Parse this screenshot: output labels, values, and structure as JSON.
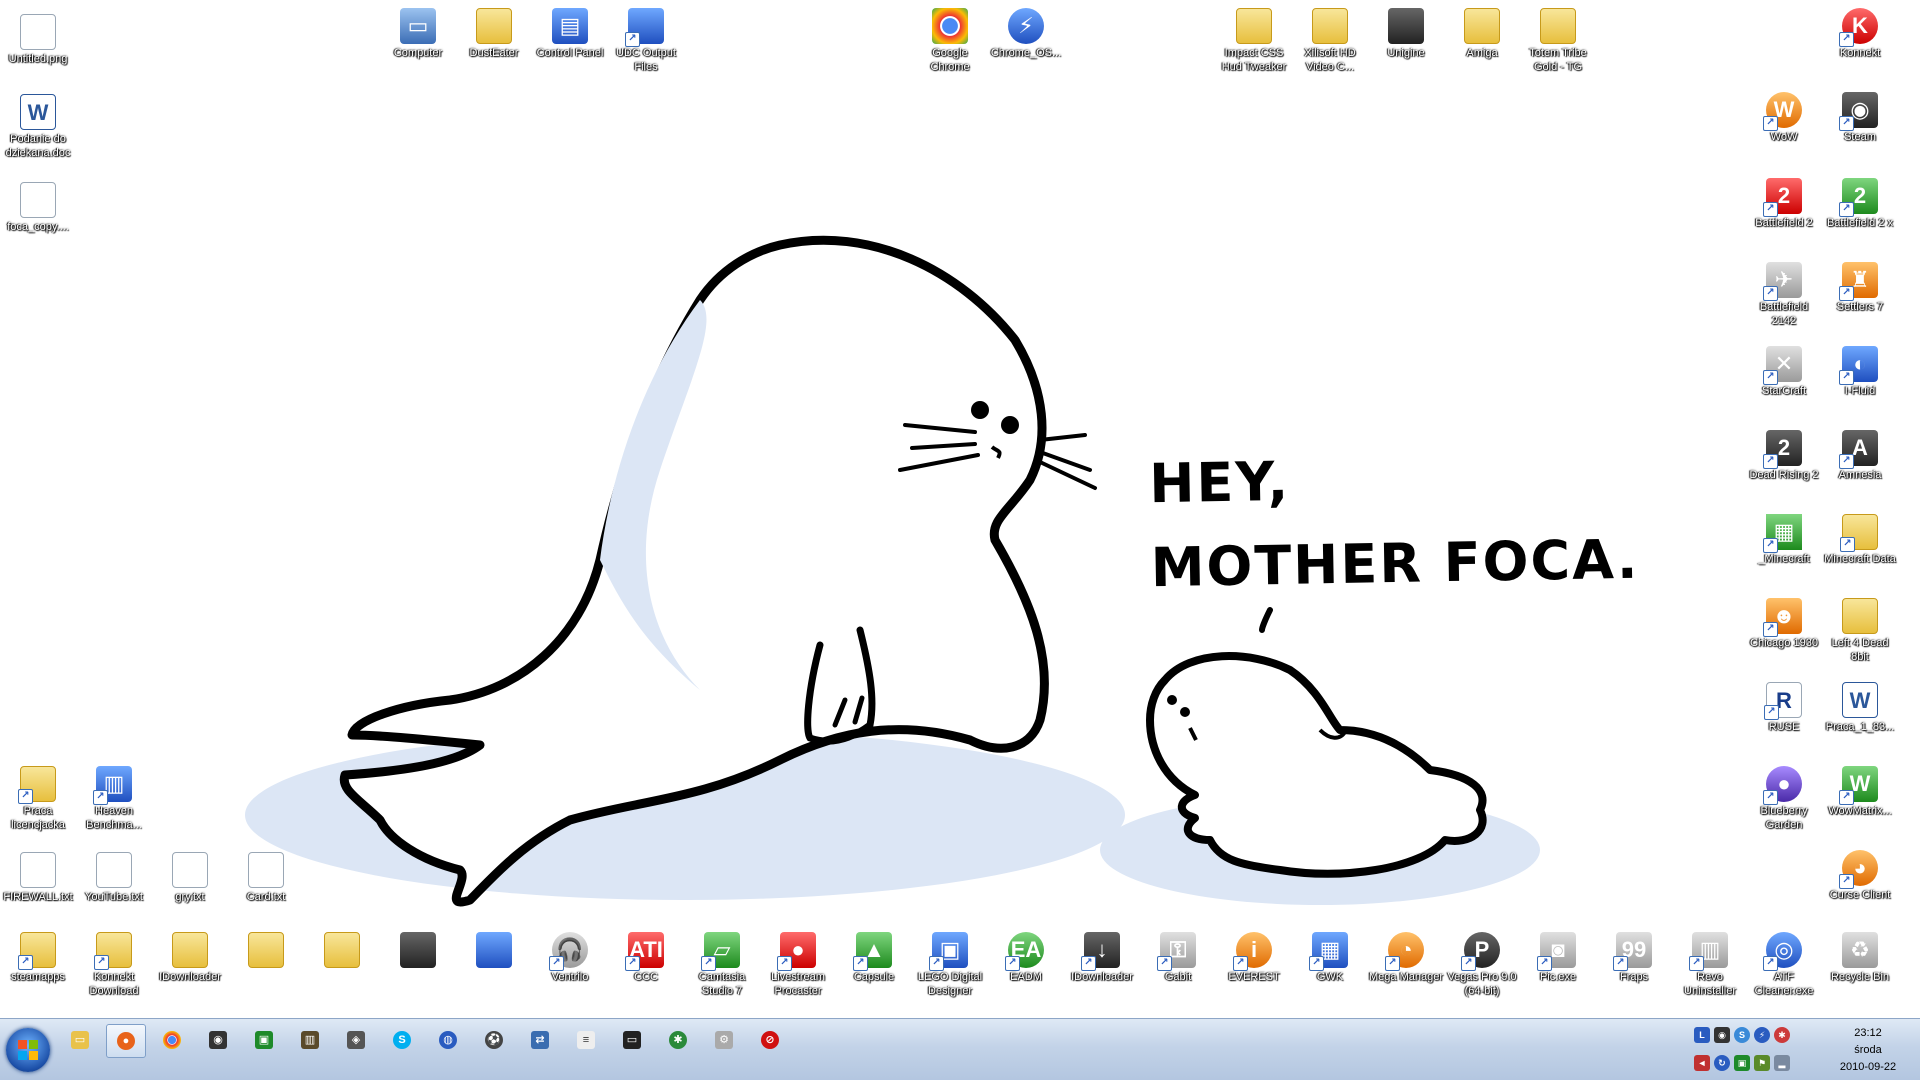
{
  "wallpaper": {
    "speech_line1": "HEY,",
    "speech_line2": "MOTHER FOCA."
  },
  "desktop_icons": {
    "untitled_png": "Untitled.png",
    "podanie_doc": "Podanie do dziekana.doc",
    "foca_copy": "foca_copy....",
    "computer": "Computer",
    "dusteater": "DustEater",
    "control_panel": "Control Panel",
    "udc_output": "UDC Output Files",
    "google_chrome": "Google Chrome",
    "chrome_os": "Chrome_OS...",
    "impact_css": "Impact CSS Hud Tweaker",
    "xilisoft": "Xilisoft HD Video C...",
    "unigine": "Unigine",
    "amiga": "Amiga",
    "totem_tribe": "Totem Tribe Gold - TG",
    "konnekt_top": "Konnekt",
    "wow": "WoW",
    "steam": "Steam",
    "bf2": "Battlefield 2",
    "bf2x": "Battlefield 2 x",
    "bf2142": "Battlefield 2142",
    "settlers7": "Settlers 7",
    "starcraft": "StarCraft",
    "i_fluid": "I-Fluid",
    "dead_rising": "Dead Rising 2",
    "amnesia": "Amnesia",
    "minecraft": "_Minecraft",
    "minecraft_data": "Minecraft Data",
    "chicago": "Chicago 1930",
    "left4dead": "Left 4 Dead 8bit",
    "ruse": "RUSE",
    "praca_doc": "Praca_1_83...",
    "blueberry": "Blueberry Garden",
    "wowmatrix": "WowMatrix...",
    "curse": "Curse Client",
    "praca_lic": "Praca licencjacka",
    "heaven": "Heaven Benchma...",
    "firewall": "FIREWALL.txt",
    "youtube": "YouTube.txt",
    "gry": "gry.txt",
    "card": "Card.txt",
    "steamapps": "steamapps",
    "konnekt_dl": "Konnekt Download",
    "idownloader_folder": "IDownloader",
    "ventrilo": "Ventrilo",
    "ccc": "CCC",
    "camtasia": "Camtasia Studio 7",
    "livestream": "Livestream Procaster",
    "capsule": "Capsule",
    "lego": "LEGO Digital Designer",
    "eadm": "EADM",
    "idownloader": "IDownloader",
    "gabit": "Gabit",
    "everest": "EVEREST",
    "gwk": "GWK",
    "mega_manager": "Mega Manager",
    "vegas": "Vegas Pro 9.0 (64-bit)",
    "pic_exe": "Pic.exe",
    "fraps": "Fraps",
    "revo": "Revo Uninstaller",
    "atf": "ATF Cleaner.exe",
    "recycle_bin": "Recycle Bin"
  },
  "taskbar": {
    "clock_time": "23:12",
    "clock_day": "środa",
    "clock_date": "2010-09-22"
  },
  "icons": [
    "windows-flag-icon",
    "explorer-icon",
    "firefox-icon",
    "chrome-icon",
    "steam-icon",
    "app-icon",
    "film-icon",
    "shield-icon",
    "skype-icon",
    "network-icon",
    "soccer-icon",
    "transfer-icon",
    "notepad-icon",
    "terminal-icon",
    "gear-icon",
    "tool-icon",
    "stop-icon"
  ],
  "colors": {
    "taskbar_top": "#dfe9f5",
    "taskbar_bottom": "#b3c6e0",
    "wallpaper_shadow": "#dce6f5"
  }
}
